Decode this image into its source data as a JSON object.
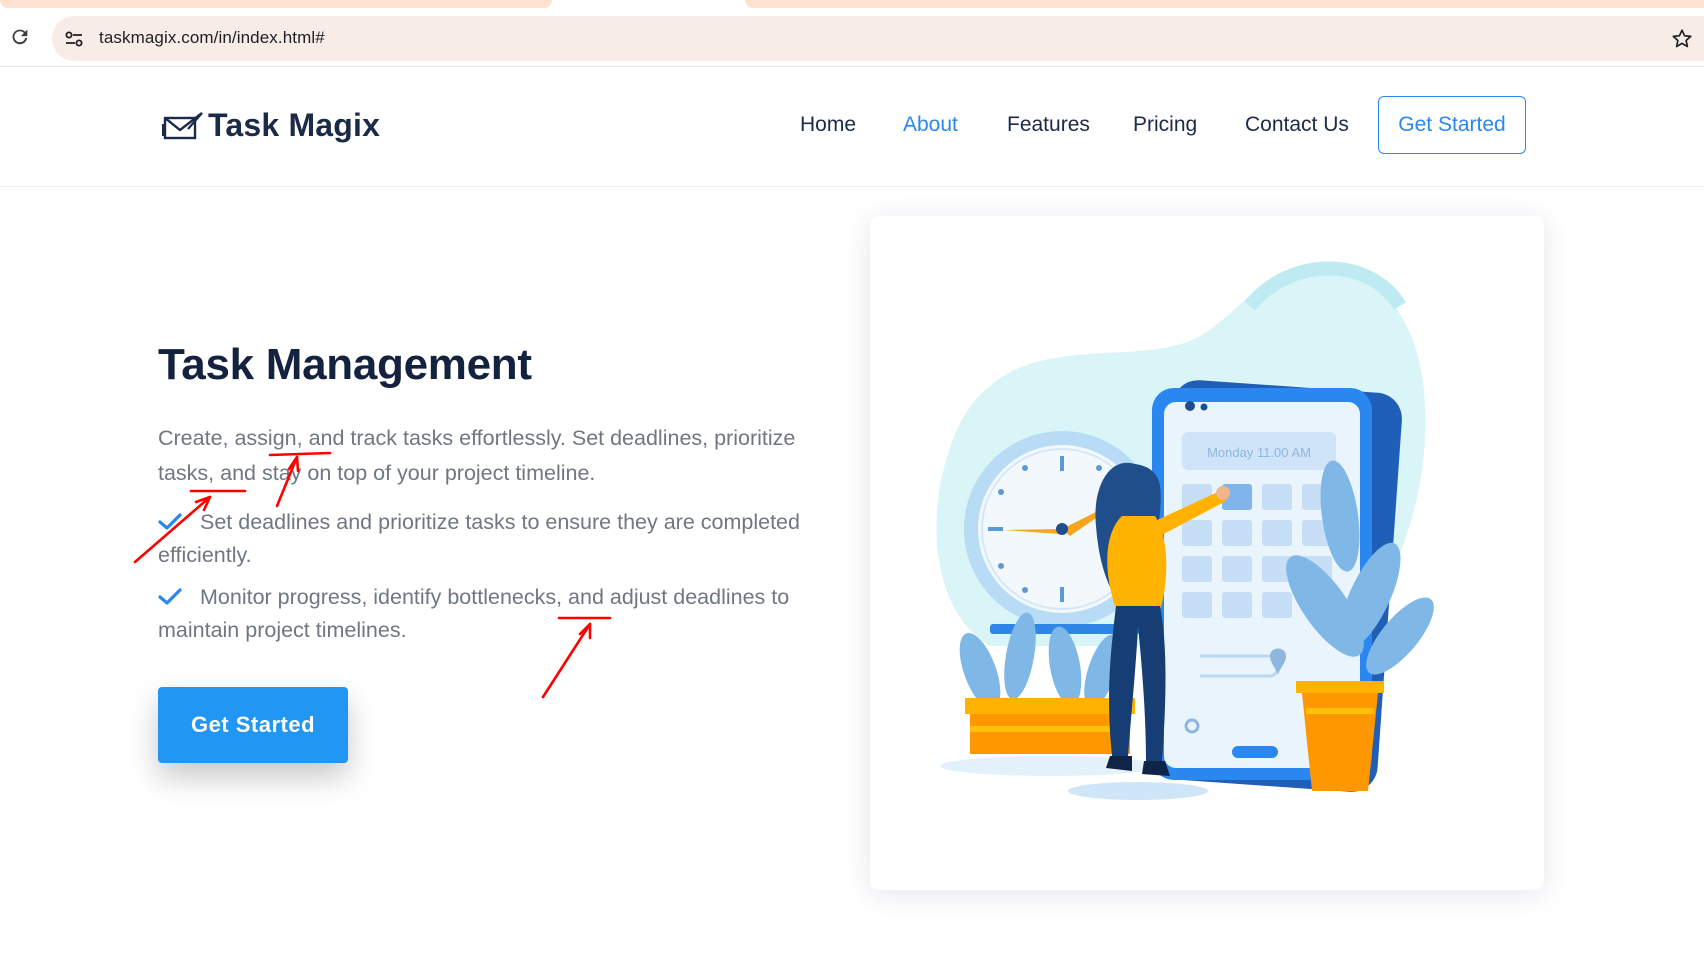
{
  "browser": {
    "url": "taskmagix.com/in/index.html#",
    "reload_icon": "reload-icon",
    "site_info_icon": "tune-icon",
    "bookmark_icon": "star-icon"
  },
  "header": {
    "brand": "Task Magix",
    "logo_icon": "paper-plane-envelope-icon",
    "nav": [
      {
        "label": "Home",
        "active": false
      },
      {
        "label": "About",
        "active": true
      },
      {
        "label": "Features",
        "active": false
      },
      {
        "label": "Pricing",
        "active": false
      },
      {
        "label": "Contact Us",
        "active": false
      }
    ],
    "cta_label": "Get Started"
  },
  "hero": {
    "title": "Task Management",
    "description": "Create, assign, and track tasks effortlessly. Set deadlines, prioritize tasks, and stay on top of your project timeline.",
    "points": [
      "Set deadlines and prioritize tasks to ensure they are completed efficiently.",
      "Monitor progress, identify bottlenecks, and adjust deadlines to maintain project timelines."
    ],
    "cta_label": "Get Started"
  },
  "illustration": {
    "calendar_label": "Monday 11.00 AM"
  },
  "colors": {
    "accent": "#2a87f0",
    "heading": "#13223f",
    "body_text": "#6f7782",
    "cta_bg": "#2196f3",
    "annotation": "#ff0000"
  }
}
